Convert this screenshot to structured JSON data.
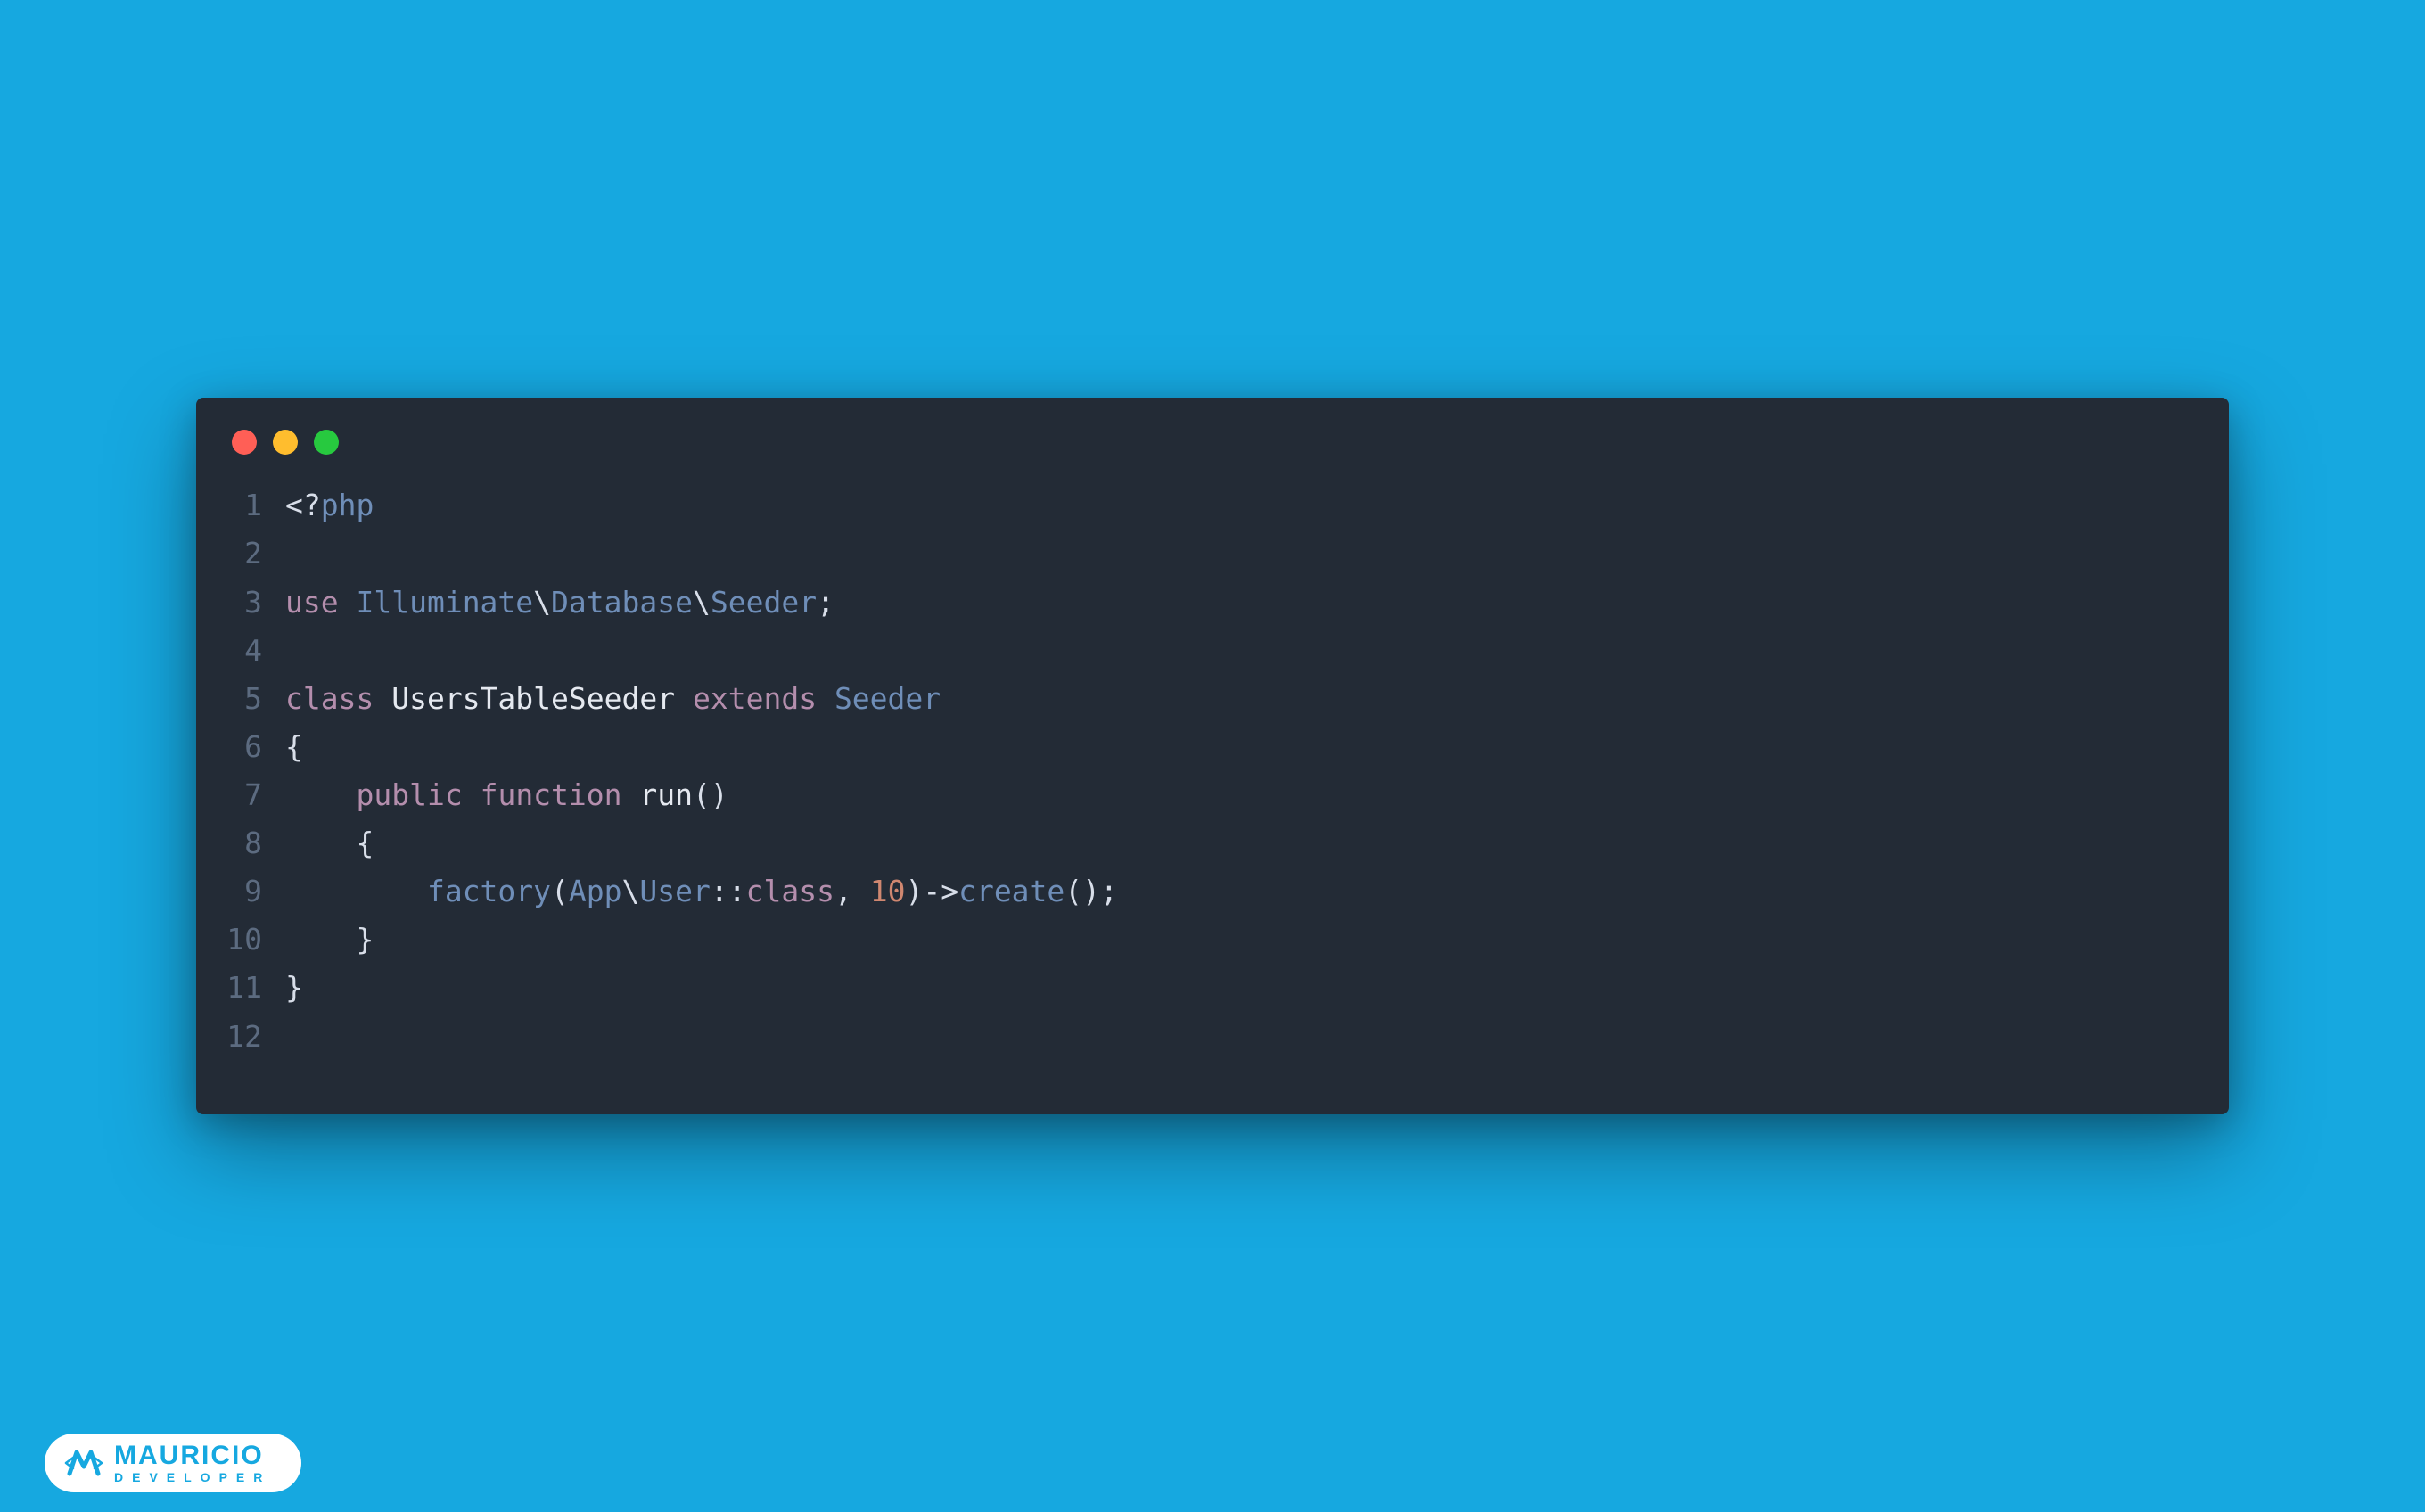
{
  "window": {
    "traffic_lights": {
      "red": "#ff5f56",
      "yellow": "#ffbd2e",
      "green": "#27c93f"
    }
  },
  "code": {
    "lines": [
      {
        "n": "1",
        "tokens": [
          {
            "t": "<?",
            "c": "punct"
          },
          {
            "t": "php",
            "c": "tag"
          }
        ]
      },
      {
        "n": "2",
        "tokens": []
      },
      {
        "n": "3",
        "tokens": [
          {
            "t": "use",
            "c": "keyword"
          },
          {
            "t": " ",
            "c": "default"
          },
          {
            "t": "Illuminate",
            "c": "class"
          },
          {
            "t": "\\",
            "c": "punct"
          },
          {
            "t": "Database",
            "c": "class"
          },
          {
            "t": "\\",
            "c": "punct"
          },
          {
            "t": "Seeder",
            "c": "class"
          },
          {
            "t": ";",
            "c": "punct"
          }
        ]
      },
      {
        "n": "4",
        "tokens": []
      },
      {
        "n": "5",
        "tokens": [
          {
            "t": "class",
            "c": "keyword"
          },
          {
            "t": " ",
            "c": "default"
          },
          {
            "t": "UsersTableSeeder",
            "c": "name"
          },
          {
            "t": " ",
            "c": "default"
          },
          {
            "t": "extends",
            "c": "keyword"
          },
          {
            "t": " ",
            "c": "default"
          },
          {
            "t": "Seeder",
            "c": "class"
          }
        ]
      },
      {
        "n": "6",
        "tokens": [
          {
            "t": "{",
            "c": "punct"
          }
        ]
      },
      {
        "n": "7",
        "tokens": [
          {
            "t": "    ",
            "c": "default"
          },
          {
            "t": "public",
            "c": "keyword"
          },
          {
            "t": " ",
            "c": "default"
          },
          {
            "t": "function",
            "c": "keyword"
          },
          {
            "t": " ",
            "c": "default"
          },
          {
            "t": "run",
            "c": "name"
          },
          {
            "t": "()",
            "c": "punct"
          }
        ]
      },
      {
        "n": "8",
        "tokens": [
          {
            "t": "    ",
            "c": "default"
          },
          {
            "t": "{",
            "c": "punct"
          }
        ]
      },
      {
        "n": "9",
        "tokens": [
          {
            "t": "        ",
            "c": "default"
          },
          {
            "t": "factory",
            "c": "func"
          },
          {
            "t": "(",
            "c": "punct"
          },
          {
            "t": "App",
            "c": "class"
          },
          {
            "t": "\\",
            "c": "punct"
          },
          {
            "t": "User",
            "c": "class"
          },
          {
            "t": "::",
            "c": "punct"
          },
          {
            "t": "class",
            "c": "keyword"
          },
          {
            "t": ", ",
            "c": "punct"
          },
          {
            "t": "10",
            "c": "num"
          },
          {
            "t": ")->",
            "c": "punct"
          },
          {
            "t": "create",
            "c": "method"
          },
          {
            "t": "();",
            "c": "punct"
          }
        ]
      },
      {
        "n": "10",
        "tokens": [
          {
            "t": "    ",
            "c": "default"
          },
          {
            "t": "}",
            "c": "punct"
          }
        ]
      },
      {
        "n": "11",
        "tokens": [
          {
            "t": "}",
            "c": "punct"
          }
        ]
      },
      {
        "n": "12",
        "tokens": []
      }
    ]
  },
  "badge": {
    "title": "MAURICIO",
    "subtitle": "DEVELOPER"
  }
}
